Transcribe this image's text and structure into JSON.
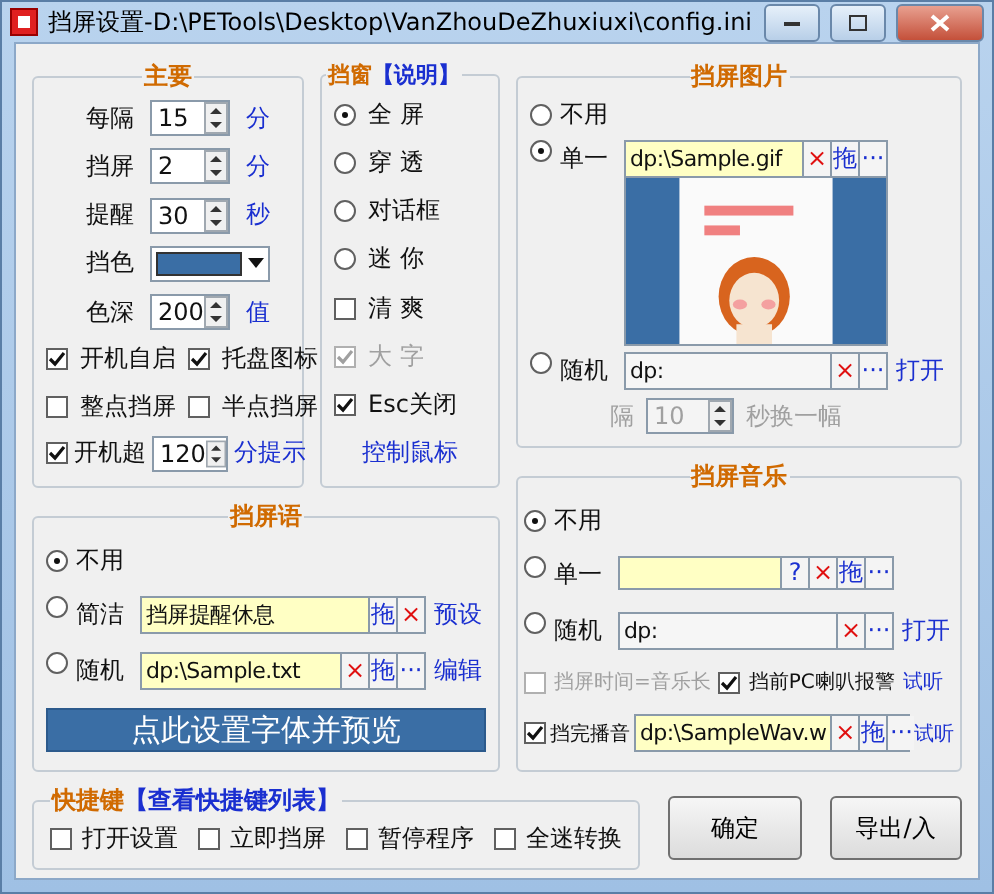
{
  "window": {
    "title": "挡屏设置-D:\\PETools\\Desktop\\VanZhouDeZhuxiuxi\\config.ini"
  },
  "main": {
    "title": "主要",
    "items": [
      {
        "kind": "spin",
        "label": "每隔",
        "value": "15",
        "unit": "分"
      },
      {
        "kind": "spin",
        "label": "挡屏",
        "value": "2",
        "unit": "分"
      },
      {
        "kind": "spin",
        "label": "提醒",
        "value": "30",
        "unit": "秒"
      },
      {
        "kind": "color",
        "label": "挡色",
        "color": "#3a6ea5"
      },
      {
        "kind": "spin",
        "label": "色深",
        "value": "200",
        "unit": "值"
      },
      {
        "kind": "checks",
        "options": [
          {
            "label": "开机自启",
            "checked": true
          },
          {
            "label": "托盘图标",
            "checked": true
          }
        ]
      },
      {
        "kind": "checks",
        "options": [
          {
            "label": "整点挡屏",
            "checked": false
          },
          {
            "label": "半点挡屏",
            "checked": false
          }
        ]
      },
      {
        "kind": "check_spin",
        "label": "开机超",
        "checked": true,
        "value": "120",
        "unit": "分提示"
      }
    ]
  },
  "win": {
    "title": "挡窗",
    "link": "【说明】",
    "options": [
      {
        "kind": "radio",
        "label": "全 屏",
        "selected": true,
        "disabled": false
      },
      {
        "kind": "radio",
        "label": "穿 透",
        "selected": false,
        "disabled": false
      },
      {
        "kind": "radio",
        "label": "对话框",
        "selected": false,
        "disabled": false
      },
      {
        "kind": "radio",
        "label": "迷 你",
        "selected": false,
        "disabled": false
      },
      {
        "kind": "check",
        "label": "清 爽",
        "checked": false,
        "disabled": false
      },
      {
        "kind": "check",
        "label": "大 字",
        "checked": true,
        "disabled": true
      },
      {
        "kind": "check",
        "label": "Esc关闭",
        "checked": true,
        "disabled": false
      }
    ],
    "footer_link": "控制鼠标"
  },
  "pic": {
    "title": "挡屏图片",
    "options": [
      {
        "kind": "none",
        "label": "不用",
        "selected": false
      },
      {
        "kind": "file",
        "label": "单一",
        "selected": true,
        "field": {
          "value": "dp:\\Sample.gif",
          "highlighted": true,
          "buttons": [
            {
              "kind": "clear",
              "label": "×"
            },
            {
              "kind": "drag",
              "label": "拖"
            },
            {
              "kind": "browse",
              "label": "···"
            }
          ]
        }
      },
      {
        "kind": "file",
        "label": "随机",
        "selected": false,
        "field": {
          "value": "dp:",
          "highlighted": false,
          "buttons": [
            {
              "kind": "clear",
              "label": "×"
            },
            {
              "kind": "browse",
              "label": "···"
            }
          ]
        },
        "link": "打开"
      }
    ],
    "interval": {
      "label": "隔",
      "value": "10",
      "unit": "秒换一幅",
      "disabled": true
    }
  },
  "music": {
    "title": "挡屏音乐",
    "options": [
      {
        "kind": "none",
        "label": "不用",
        "selected": true
      },
      {
        "kind": "file",
        "label": "单一",
        "selected": false,
        "field": {
          "highlighted": true,
          "buttons": [
            {
              "kind": "help",
              "label": "?"
            },
            {
              "kind": "clear",
              "label": "×"
            },
            {
              "kind": "drag",
              "label": "拖"
            },
            {
              "kind": "browse",
              "label": "···"
            }
          ]
        }
      },
      {
        "kind": "file",
        "label": "随机",
        "selected": false,
        "field": {
          "value": "dp:",
          "highlighted": false,
          "buttons": [
            {
              "kind": "clear",
              "label": "×"
            },
            {
              "kind": "browse",
              "label": "···"
            }
          ]
        },
        "link": "打开"
      }
    ],
    "checks": [
      {
        "label": "挡屏时间=音乐长",
        "checked": false,
        "disabled": true
      },
      {
        "label": "挡前PC喇叭报警",
        "checked": true,
        "disabled": false
      }
    ],
    "checks_link": "试听",
    "end_sound": {
      "label": "挡完播音",
      "checked": true,
      "field": {
        "value": "dp:\\SampleWav.w",
        "highlighted": true,
        "buttons": [
          {
            "kind": "clear",
            "label": "×"
          },
          {
            "kind": "drag",
            "label": "拖"
          },
          {
            "kind": "browse",
            "label": "···"
          }
        ]
      },
      "link": "试听"
    }
  },
  "say": {
    "title": "挡屏语",
    "options": [
      {
        "kind": "none",
        "label": "不用",
        "selected": true
      },
      {
        "kind": "file",
        "label": "简洁",
        "selected": false,
        "field": {
          "value": "挡屏提醒休息",
          "highlighted": true,
          "buttons": [
            {
              "kind": "drag",
              "label": "拖"
            },
            {
              "kind": "clear",
              "label": "×"
            }
          ]
        },
        "link": "预设"
      },
      {
        "kind": "file",
        "label": "随机",
        "selected": false,
        "field": {
          "value": "dp:\\Sample.txt",
          "highlighted": true,
          "buttons": [
            {
              "kind": "clear",
              "label": "×"
            },
            {
              "kind": "drag",
              "label": "拖"
            },
            {
              "kind": "browse",
              "label": "···"
            }
          ]
        },
        "link": "编辑"
      }
    ],
    "button": "点此设置字体并预览"
  },
  "keys": {
    "title": "快捷键",
    "link": "【查看快捷键列表】",
    "options": [
      {
        "label": "打开设置",
        "checked": false
      },
      {
        "label": "立即挡屏",
        "checked": false
      },
      {
        "label": "暂停程序",
        "checked": false
      },
      {
        "label": "全迷转换",
        "checked": false
      }
    ]
  },
  "buttons": [
    {
      "label": "确定"
    },
    {
      "label": "导出/入"
    }
  ]
}
